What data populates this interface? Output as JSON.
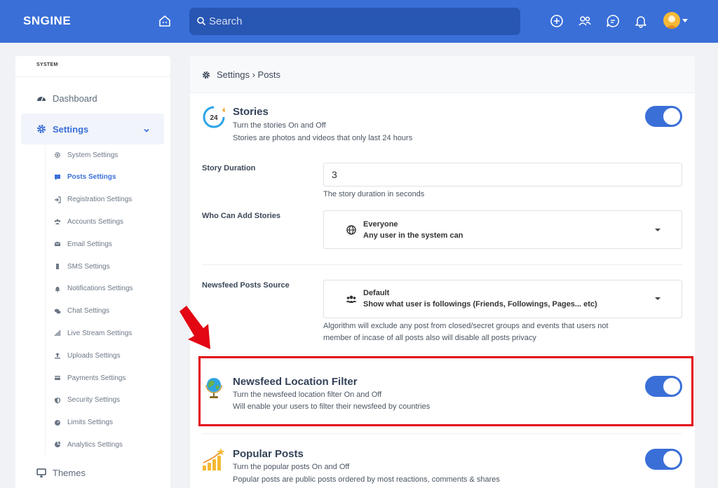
{
  "header": {
    "logo": "SNGINE",
    "search_placeholder": "Search"
  },
  "sidebar": {
    "section_title": "SYSTEM",
    "dashboard_label": "Dashboard",
    "settings_label": "Settings",
    "themes_label": "Themes",
    "sub_items": [
      {
        "label": "System Settings",
        "icon": "gears-icon"
      },
      {
        "label": "Posts Settings",
        "icon": "comment-icon",
        "active": true
      },
      {
        "label": "Registration Settings",
        "icon": "sign-in-icon"
      },
      {
        "label": "Accounts Settings",
        "icon": "users-icon"
      },
      {
        "label": "Email Settings",
        "icon": "envelope-icon"
      },
      {
        "label": "SMS Settings",
        "icon": "mobile-icon"
      },
      {
        "label": "Notifications Settings",
        "icon": "bell-icon"
      },
      {
        "label": "Chat Settings",
        "icon": "comments-icon"
      },
      {
        "label": "Live Stream Settings",
        "icon": "signal-icon"
      },
      {
        "label": "Uploads Settings",
        "icon": "upload-icon"
      },
      {
        "label": "Payments Settings",
        "icon": "credit-card-icon"
      },
      {
        "label": "Security Settings",
        "icon": "shield-icon"
      },
      {
        "label": "Limits Settings",
        "icon": "gauge-icon"
      },
      {
        "label": "Analytics Settings",
        "icon": "pie-chart-icon"
      }
    ]
  },
  "content": {
    "breadcrumb": "Settings › Posts",
    "stories": {
      "title": "Stories",
      "line1": "Turn the stories On and Off",
      "line2": "Stories are photos and videos that only last 24 hours",
      "icon_text": "24",
      "enabled": true
    },
    "story_duration": {
      "label": "Story Duration",
      "value": "3",
      "help": "The story duration in seconds"
    },
    "who_can_add": {
      "label": "Who Can Add Stories",
      "selected_title": "Everyone",
      "selected_desc": "Any user in the system can"
    },
    "newsfeed_source": {
      "label": "Newsfeed Posts Source",
      "selected_title": "Default",
      "selected_desc": "Show what user is followings (Friends, Followings, Pages... etc)",
      "help_line1": "Algorithm will exclude any post from closed/secret groups and events that users not",
      "help_line2": "member of incase of all posts also will disable all posts privacy"
    },
    "location_filter": {
      "title": "Newsfeed Location Filter",
      "line1": "Turn the newsfeed location filter On and Off",
      "line2": "Will enable your users to filter their newsfeed by countries",
      "enabled": true
    },
    "popular_posts": {
      "title": "Popular Posts",
      "line1": "Turn the popular posts On and Off",
      "line2": "Popular posts are public posts ordered by most reactions, comments & shares",
      "enabled": true
    }
  },
  "colors": {
    "accent": "#3a6fd8",
    "highlight": "#e30613"
  }
}
